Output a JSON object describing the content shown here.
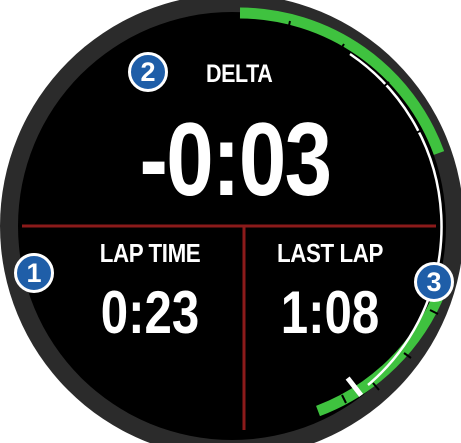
{
  "fields": {
    "delta": {
      "label": "DELTA",
      "value": "-0:03"
    },
    "lap_time": {
      "label": "LAP TIME",
      "value": "0:23"
    },
    "last_lap": {
      "label": "LAST LAP",
      "value": "1:08"
    }
  },
  "callouts": [
    {
      "number": "1",
      "refers_to": "LAP TIME"
    },
    {
      "number": "2",
      "refers_to": "DELTA"
    },
    {
      "number": "3",
      "refers_to": "LAST LAP"
    }
  ],
  "colors": {
    "bezel": "#2b2b2b",
    "screen": "#000000",
    "divider": "#8b1a1a",
    "gauge_green": "#3fc23f",
    "gauge_marker": "#ffffff",
    "callout_fill": "#1f5ea8",
    "text": "#ffffff"
  },
  "icons": {
    "callout": "numbered-circle",
    "gauge": "progress-arc"
  }
}
